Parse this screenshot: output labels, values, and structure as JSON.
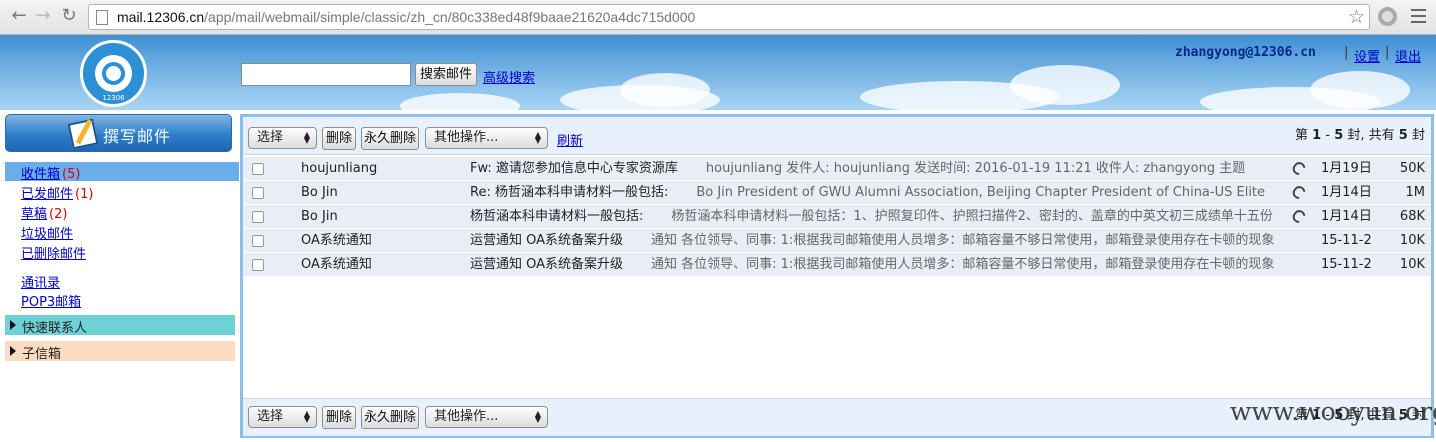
{
  "browser": {
    "url_host": "mail.12306.cn",
    "url_path": "/app/mail/webmail/simple/classic/zh_cn/80c338ed48f9baae21620a4dc715d000"
  },
  "header": {
    "logo_number": "12306",
    "search_placeholder": "",
    "search_button": "搜索邮件",
    "advanced_search": "高级搜索",
    "user_email": "zhangyong@12306.cn",
    "settings": "设置",
    "logout": "退出"
  },
  "sidebar": {
    "compose": "撰写邮件",
    "folders": [
      {
        "label": "收件箱",
        "count": "(5)"
      },
      {
        "label": "已发邮件",
        "count": "(1)"
      },
      {
        "label": "草稿",
        "count": "(2)"
      },
      {
        "label": "垃圾邮件",
        "count": ""
      },
      {
        "label": "已删除邮件",
        "count": ""
      }
    ],
    "contacts": "通讯录",
    "pop3": "POP3邮箱",
    "quick_contacts": "快速联系人",
    "subfolders": "子信箱"
  },
  "toolbar": {
    "select": "选择",
    "delete": "删除",
    "perm_delete": "永久删除",
    "other_ops": "其他操作...",
    "refresh": "刷新",
    "pager": {
      "prefix": "第",
      "from": "1",
      "dash": "-",
      "to": "5",
      "unit": "封, 共有",
      "total": "5",
      "suffix": "封"
    }
  },
  "messages": [
    {
      "from": "houjunliang",
      "subject": "Fw: 邀请您参加信息中心专家资源库",
      "summary": "houjunliang 发件人: houjunliang 发送时间: 2016-01-19 11:21 收件人: zhangyong 主题",
      "attachment": true,
      "date": "1月19日",
      "size": "50K"
    },
    {
      "from": "Bo Jin",
      "subject": "Re: 杨哲涵本科申请材料一般包括:",
      "summary": "Bo Jin President of GWU Alumni Association, Beijing Chapter President of China-US Elite",
      "attachment": true,
      "date": "1月14日",
      "size": "1M"
    },
    {
      "from": "Bo Jin",
      "subject": "杨哲涵本科申请材料一般包括:",
      "summary": "杨哲涵本科申请材料一般包括：1、护照复印件、护照扫描件2、密封的、盖章的中英文初三成绩单十五份",
      "attachment": true,
      "date": "1月14日",
      "size": "68K"
    },
    {
      "from": "OA系统通知",
      "subject": "运营通知 OA系统备案升级",
      "summary": "通知 各位领导、同事: 1:根据我司邮箱使用人员增多：邮箱容量不够日常使用，邮箱登录使用存在卡顿的现象",
      "attachment": false,
      "date": "15-11-2",
      "size": "10K"
    },
    {
      "from": "OA系统通知",
      "subject": "运营通知 OA系统备案升级",
      "summary": "通知 各位领导、同事: 1:根据我司邮箱使用人员增多：邮箱容量不够日常使用，邮箱登录使用存在卡顿的现象",
      "attachment": false,
      "date": "15-11-2",
      "size": "10K"
    }
  ],
  "watermark": "www.wooyun.org"
}
